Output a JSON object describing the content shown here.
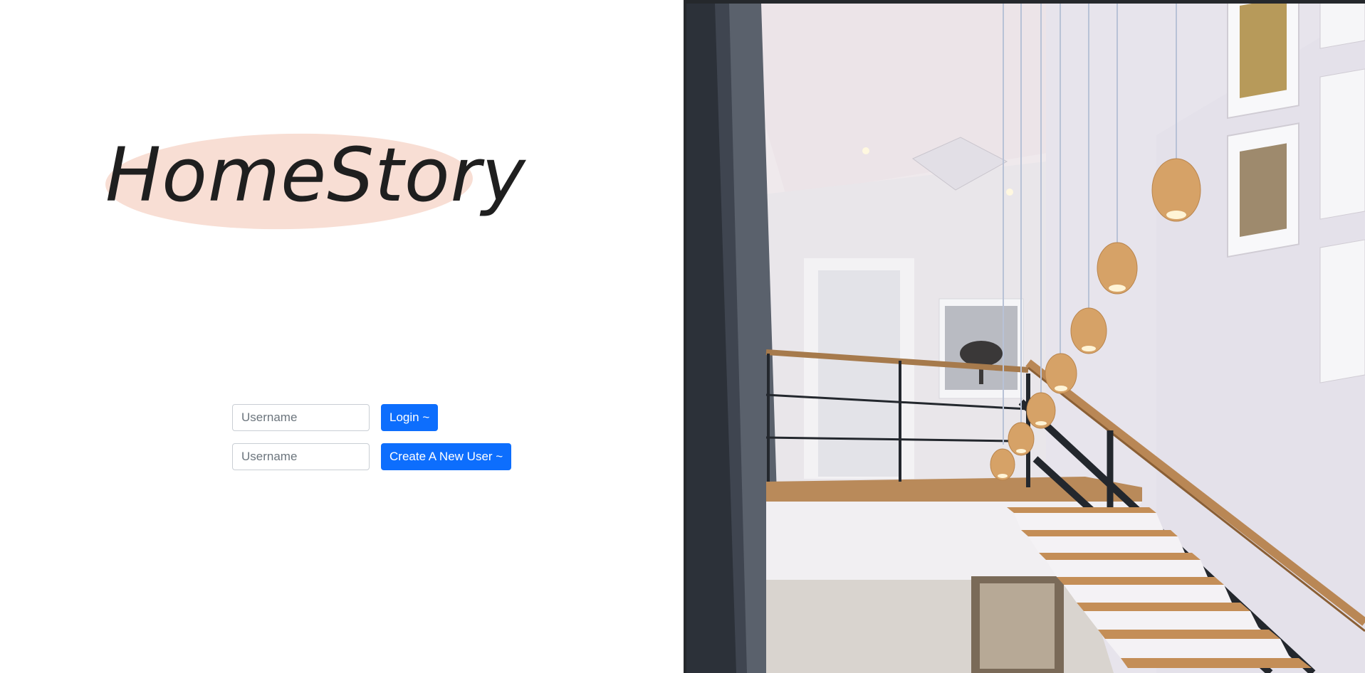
{
  "brand": {
    "name": "HomeStory",
    "accent": "#f8ded4"
  },
  "login": {
    "username_placeholder": "Username",
    "login_label": "Login ~"
  },
  "register": {
    "username_placeholder": "Username",
    "create_label": "Create A New User ~"
  },
  "colors": {
    "primary": "#0d6efd"
  },
  "hero_image": {
    "subject": "staircase interior with pendant bulb lights",
    "icon": "photo"
  }
}
